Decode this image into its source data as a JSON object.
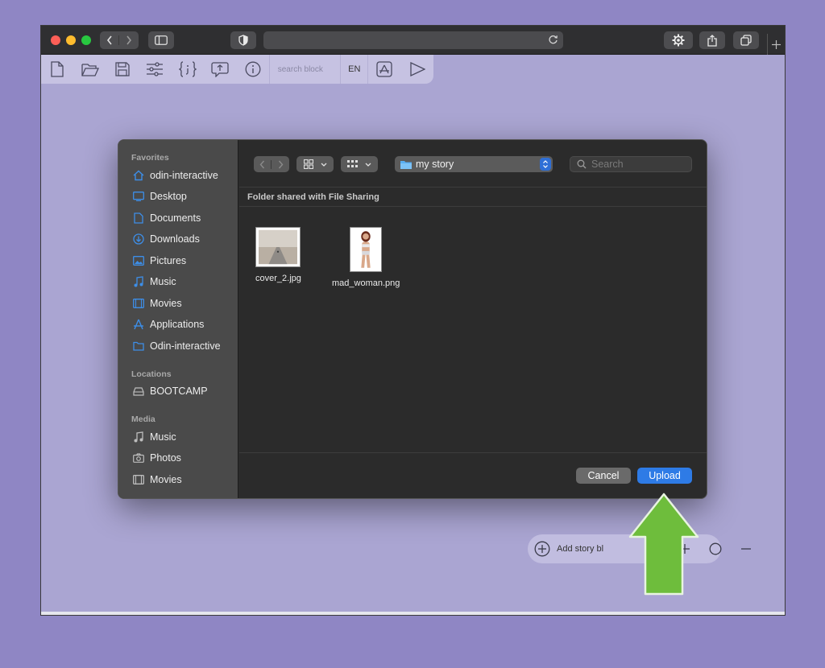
{
  "toolbar": {
    "search_placeholder": "search block",
    "language": "EN"
  },
  "dialog": {
    "sidebar": {
      "favorites_title": "Favorites",
      "favorites": [
        {
          "label": "odin-interactive",
          "icon": "home-icon"
        },
        {
          "label": "Desktop",
          "icon": "desktop-icon"
        },
        {
          "label": "Documents",
          "icon": "document-icon"
        },
        {
          "label": "Downloads",
          "icon": "download-icon"
        },
        {
          "label": "Pictures",
          "icon": "pictures-icon"
        },
        {
          "label": "Music",
          "icon": "music-icon"
        },
        {
          "label": "Movies",
          "icon": "movies-icon"
        },
        {
          "label": "Applications",
          "icon": "applications-icon"
        },
        {
          "label": "Odin-interactive",
          "icon": "folder-icon"
        }
      ],
      "locations_title": "Locations",
      "locations": [
        {
          "label": "BOOTCAMP",
          "icon": "drive-icon"
        }
      ],
      "media_title": "Media",
      "media": [
        {
          "label": "Music",
          "icon": "music-icon"
        },
        {
          "label": "Photos",
          "icon": "camera-icon"
        },
        {
          "label": "Movies",
          "icon": "movies-icon"
        }
      ]
    },
    "current_folder": "my story",
    "search_placeholder": "Search",
    "folder_header": "Folder shared with File Sharing",
    "files": [
      {
        "name": "cover_2.jpg"
      },
      {
        "name": "mad_woman.png"
      }
    ],
    "cancel_label": "Cancel",
    "upload_label": "Upload"
  },
  "bottom_bar": {
    "add_label": "Add story bl"
  },
  "colors": {
    "page_bg": "#8f86c4",
    "accent_blue": "#2e7be6",
    "arrow_green": "#6ebd3c"
  }
}
